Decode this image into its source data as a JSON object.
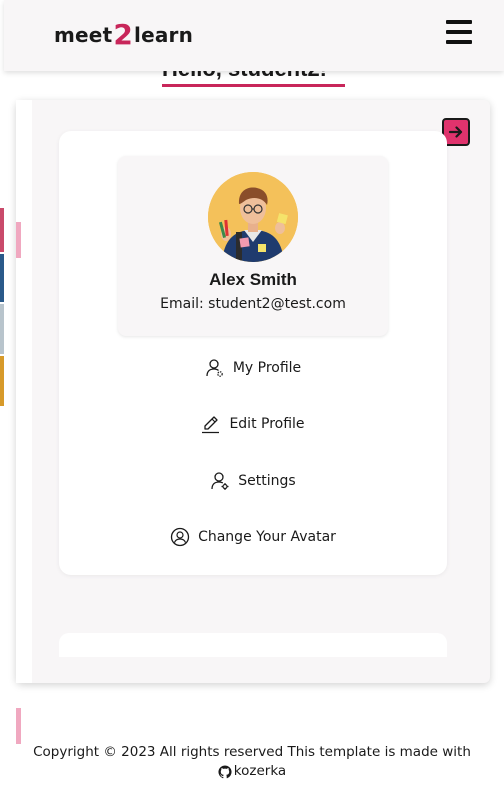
{
  "header": {
    "logo": {
      "part1": "meet",
      "part2": "2",
      "part3": "learn"
    },
    "menu_icon": "hamburger-icon"
  },
  "greeting": "Hello, student2!",
  "exit_icon": "exit-arrow-icon",
  "profile": {
    "name": "Alex Smith",
    "email": "Email: student2@test.com"
  },
  "menu": [
    {
      "label": "My Profile",
      "icon": "user-icon"
    },
    {
      "label": "Edit Profile",
      "icon": "pencil-icon"
    },
    {
      "label": "Settings",
      "icon": "user-settings-icon"
    },
    {
      "label": "Change Your Avatar",
      "icon": "avatar-circle-icon"
    }
  ],
  "footer": {
    "text": "Copyright © 2023 All rights reserved This template is made with",
    "brand": "kozerka",
    "brand_icon": "github-icon"
  },
  "colors": {
    "accent": "#c8265a",
    "exit_button": "#e0336d",
    "panel": "#f8f6f7"
  }
}
